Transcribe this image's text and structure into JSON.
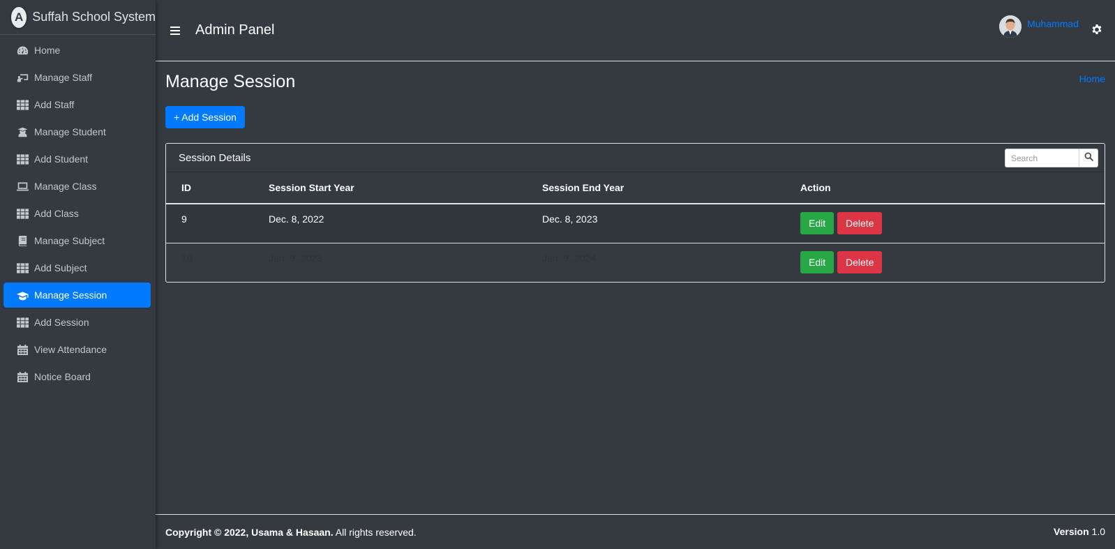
{
  "brand": {
    "name": "Suffah School System",
    "logo_letter": "A"
  },
  "sidebar": {
    "items": [
      {
        "label": "Home",
        "icon": "tachometer-icon"
      },
      {
        "label": "Manage Staff",
        "icon": "chalkboard-teacher-icon"
      },
      {
        "label": "Add Staff",
        "icon": "table-icon"
      },
      {
        "label": "Manage Student",
        "icon": "user-graduate-icon"
      },
      {
        "label": "Add Student",
        "icon": "table-icon"
      },
      {
        "label": "Manage Class",
        "icon": "laptop-icon"
      },
      {
        "label": "Add Class",
        "icon": "table-icon"
      },
      {
        "label": "Manage Subject",
        "icon": "book-icon"
      },
      {
        "label": "Add Subject",
        "icon": "table-icon"
      },
      {
        "label": "Manage Session",
        "icon": "graduation-cap-icon",
        "active": true
      },
      {
        "label": "Add Session",
        "icon": "table-icon"
      },
      {
        "label": "View Attendance",
        "icon": "calendar-icon"
      },
      {
        "label": "Notice Board",
        "icon": "calendar-icon"
      }
    ]
  },
  "header": {
    "title": "Admin Panel",
    "user_name": "Muhammad"
  },
  "page": {
    "title": "Manage Session",
    "breadcrumb": "Home",
    "add_button": "+ Add Session"
  },
  "card": {
    "title": "Session Details",
    "search": {
      "placeholder": "Search",
      "value": ""
    },
    "columns": [
      "ID",
      "Session Start Year",
      "Session End Year",
      "Action"
    ],
    "rows": [
      {
        "id": "9",
        "start": "Dec. 8, 2022",
        "end": "Dec. 8, 2023",
        "edit": "Edit",
        "delete": "Delete"
      },
      {
        "id": "10",
        "start": "Jan. 9, 2023",
        "end": "Jan. 9, 2024",
        "edit": "Edit",
        "delete": "Delete"
      }
    ]
  },
  "footer": {
    "copyright_bold": "Copyright © 2022, Usama & Hasaan.",
    "copyright_rest": " All rights reserved.",
    "version_label": "Version",
    "version_value": " 1.0"
  },
  "colors": {
    "primary": "#007bff",
    "success": "#28a745",
    "danger": "#dc3545",
    "background": "#343a40"
  }
}
